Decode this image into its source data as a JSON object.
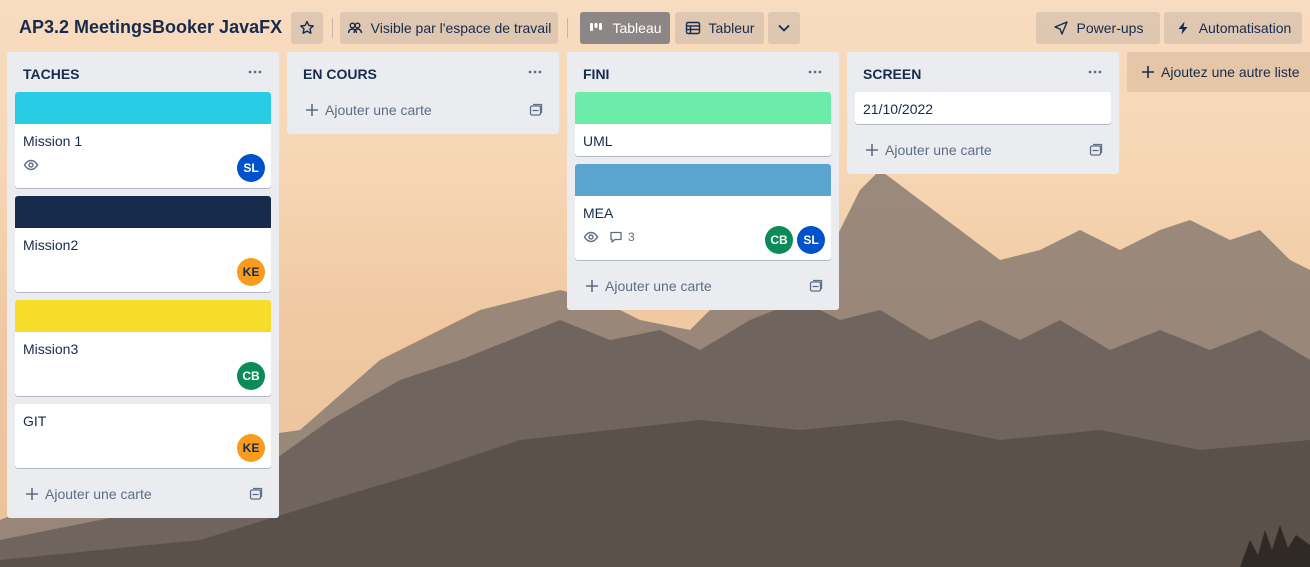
{
  "colors": {
    "cyan": "#29cce5",
    "navy": "#172b4d",
    "yellow": "#f5dd29",
    "green": "#6deca9",
    "blue": "#5ba4cf",
    "avatar_sl": "#0052cc",
    "avatar_ke": "#f99b1c",
    "avatar_cb": "#0a8b58"
  },
  "header": {
    "board_title": "AP3.2 MeetingsBooker JavaFX",
    "star_icon": "star-icon",
    "visibility_label": "Visible par l'espace de travail",
    "view_board_label": "Tableau",
    "view_table_label": "Tableur",
    "powerups_label": "Power-ups",
    "automation_label": "Automatisation"
  },
  "lists": [
    {
      "title": "TACHES",
      "add_card": "Ajouter une carte",
      "cards": [
        {
          "title": "Mission 1",
          "cover": "cyan",
          "members": [
            "SL"
          ],
          "watching": true
        },
        {
          "title": "Mission2",
          "cover": "navy",
          "members": [
            "KE"
          ]
        },
        {
          "title": "Mission3",
          "cover": "yellow",
          "members": [
            "CB"
          ]
        },
        {
          "title": "GIT",
          "members": [
            "KE"
          ]
        }
      ]
    },
    {
      "title": "EN COURS",
      "add_card": "Ajouter une carte",
      "cards": []
    },
    {
      "title": "FINI",
      "add_card": "Ajouter une carte",
      "cards": [
        {
          "title": "UML",
          "cover": "green",
          "members": []
        },
        {
          "title": "MEA",
          "cover": "blue",
          "members": [
            "CB",
            "SL"
          ],
          "watching": true,
          "comments": "3"
        }
      ]
    },
    {
      "title": "SCREEN",
      "add_card": "Ajouter une carte",
      "cards": [
        {
          "title": "21/10/2022",
          "members": []
        }
      ]
    }
  ],
  "add_list_label": "Ajoutez une autre liste"
}
